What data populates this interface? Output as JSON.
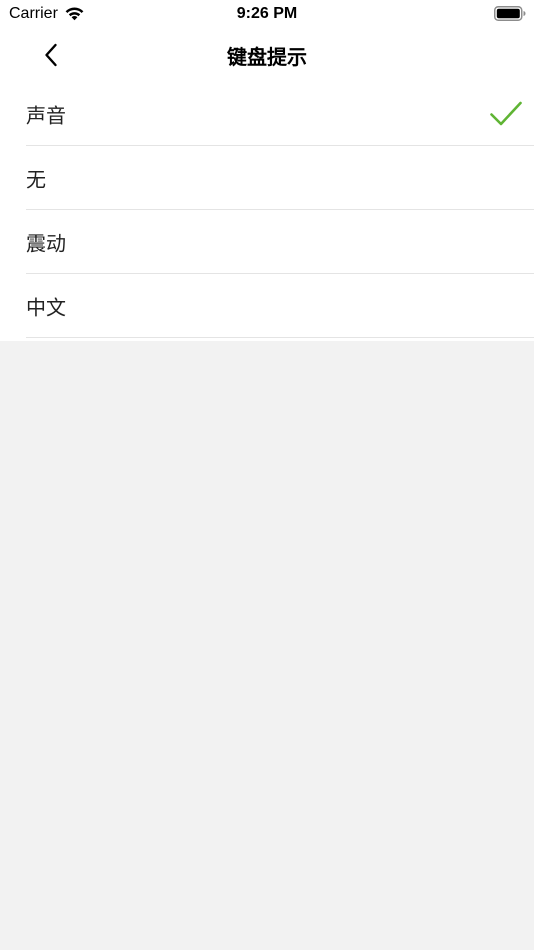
{
  "status_bar": {
    "carrier": "Carrier",
    "time": "9:26 PM"
  },
  "nav": {
    "title": "键盘提示",
    "back_icon": "chevron-left-icon"
  },
  "options": [
    {
      "label": "声音",
      "selected": true
    },
    {
      "label": "无",
      "selected": false
    },
    {
      "label": "震动",
      "selected": false
    },
    {
      "label": "中文",
      "selected": false
    }
  ],
  "colors": {
    "accent_check": "#5fb434",
    "background": "#f2f2f2",
    "surface": "#ffffff",
    "divider": "#e4e4e4"
  }
}
